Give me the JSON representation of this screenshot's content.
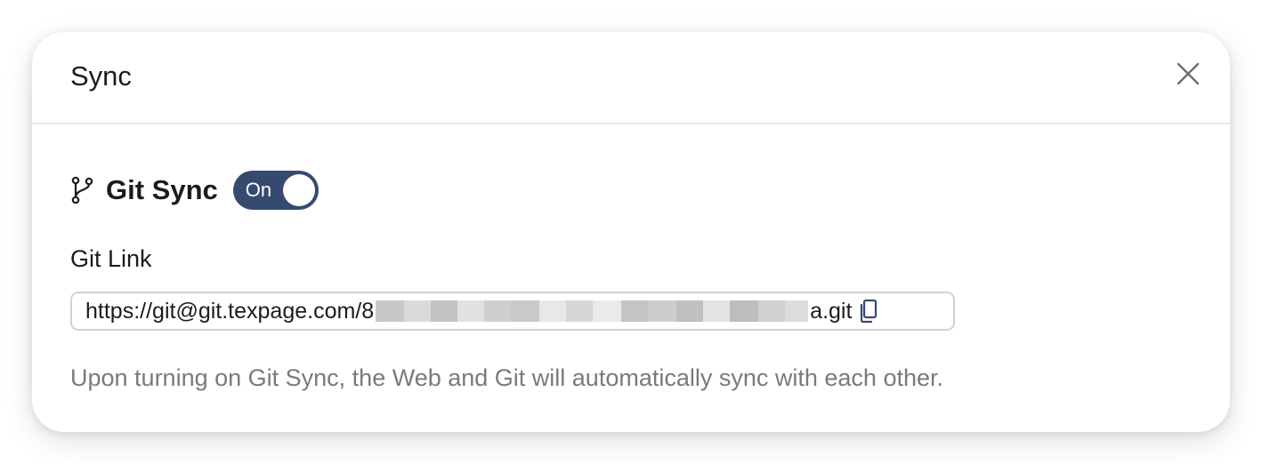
{
  "dialog": {
    "title": "Sync",
    "close_icon": "close-icon"
  },
  "git_sync": {
    "icon": "git-branch-icon",
    "title": "Git Sync",
    "toggle_label": "On",
    "enabled": true,
    "toggle_color": "#364a70"
  },
  "git_link": {
    "label": "Git Link",
    "url_prefix": "https://git@git.texpage.com/8",
    "url_suffix": "a.git",
    "copy_icon": "copy-icon"
  },
  "help_text": "Upon turning on Git Sync, the Web and Git will automatically sync with each other."
}
